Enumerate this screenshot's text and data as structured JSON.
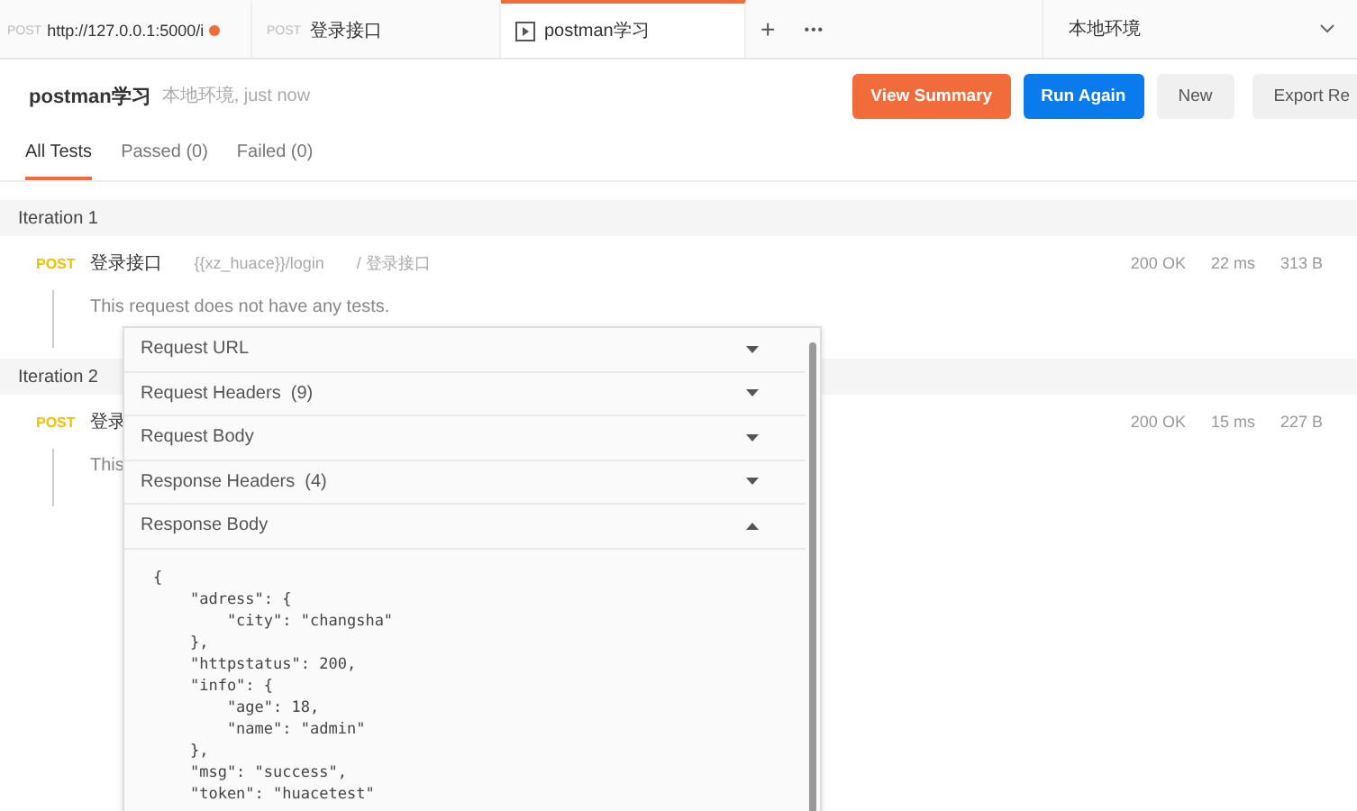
{
  "tabs": [
    {
      "method": "POST",
      "label": "http://127.0.0.1:5000/i",
      "unsaved": true,
      "selected": false,
      "kind": "request"
    },
    {
      "method": "POST",
      "label": "登录接口",
      "unsaved": false,
      "selected": false,
      "kind": "request"
    },
    {
      "label": "postman学习",
      "unsaved": false,
      "selected": true,
      "kind": "runner"
    }
  ],
  "tab_actions": {
    "add": "+",
    "more": "•••"
  },
  "environment": {
    "value": "本地环境"
  },
  "run": {
    "title": "postman学习",
    "meta": "本地环境, just now",
    "buttons": [
      {
        "label": "View Summary",
        "kind": "warn"
      },
      {
        "label": "Run Again",
        "kind": "primary"
      },
      {
        "label": "New",
        "kind": "plain"
      },
      {
        "label": "Export Re",
        "kind": "plain"
      }
    ]
  },
  "filters": [
    {
      "label": "All Tests",
      "selected": true
    },
    {
      "label": "Passed (0)",
      "selected": false
    },
    {
      "label": "Failed (0)",
      "selected": false
    }
  ],
  "iterations": [
    {
      "title": "Iteration 1",
      "method": "POST",
      "name": "登录接口",
      "url": "{{xz_huace}}/login",
      "path": "/ 登录接口",
      "status": "200 OK",
      "time": "22 ms",
      "size": "313 B",
      "message": "This request does not have any tests."
    },
    {
      "title": "Iteration 2",
      "method": "POST",
      "name": "登录",
      "status": "200 OK",
      "time": "15 ms",
      "size": "227 B",
      "message": "This"
    }
  ],
  "details": {
    "sections": [
      {
        "label": "Request URL",
        "expanded": false
      },
      {
        "label": "Request Headers",
        "count": "(9)",
        "expanded": false
      },
      {
        "label": "Request Body",
        "expanded": false
      },
      {
        "label": "Response Headers",
        "count": "(4)",
        "expanded": false
      },
      {
        "label": "Response Body",
        "expanded": true
      }
    ],
    "body_lines": [
      "{",
      "    \"adress\": {",
      "        \"city\": \"changsha\"",
      "    },",
      "    \"httpstatus\": 200,",
      "    \"info\": {",
      "        \"age\": 18,",
      "        \"name\": \"admin\"",
      "    },",
      "    \"msg\": \"success\",",
      "    \"token\": \"huacetest\""
    ]
  }
}
